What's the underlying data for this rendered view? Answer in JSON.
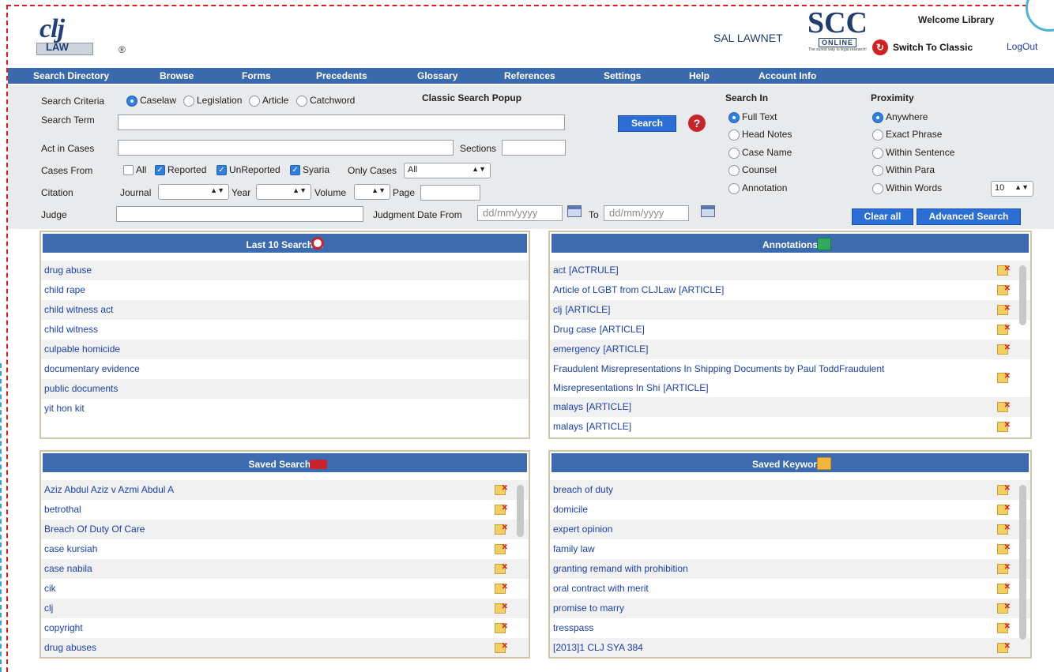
{
  "header": {
    "logo_text": "clj",
    "logo_sub": "LAW",
    "registered": "®",
    "partner1": "SAL LAWNET",
    "partner2_big": "SCC",
    "partner2_sub": "ONLINE",
    "partner2_tagline": "The surest way to legal research!",
    "welcome": "Welcome Library",
    "switch_label": "Switch To Classic",
    "logout_label": "LogOut"
  },
  "nav": {
    "items": [
      "Search Directory",
      "Browse",
      "Forms",
      "Precedents",
      "Glossary",
      "References",
      "Settings",
      "Help",
      "Account Info"
    ]
  },
  "search": {
    "criteria_label": "Search Criteria",
    "criteria_options": [
      "Caselaw",
      "Legislation",
      "Article",
      "Catchword"
    ],
    "criteria_selected": "Caselaw",
    "classic_popup_label": "Classic Search Popup",
    "search_term_label": "Search Term",
    "search_term_value": "",
    "search_button": "Search",
    "help_icon": "?",
    "act_label": "Act in Cases",
    "act_value": "",
    "sections_label": "Sections",
    "sections_value": "",
    "cases_from_label": "Cases From",
    "cases_from_options": [
      {
        "label": "All",
        "checked": false
      },
      {
        "label": "Reported",
        "checked": true
      },
      {
        "label": "UnReported",
        "checked": true
      },
      {
        "label": "Syaria",
        "checked": true
      }
    ],
    "only_cases_label": "Only Cases",
    "only_cases_value": "All",
    "citation_label": "Citation",
    "journal_label": "Journal",
    "journal_value": "",
    "year_label": "Year",
    "year_value": "",
    "volume_label": "Volume",
    "volume_value": "",
    "page_label": "Page",
    "page_value": "",
    "judge_label": "Judge",
    "judge_value": "",
    "judgment_date_label": "Judgment Date From",
    "date_from_placeholder": "dd/mm/yyyy",
    "to_label": "To",
    "date_to_placeholder": "dd/mm/yyyy",
    "search_in_label": "Search In",
    "search_in_options": [
      "Full Text",
      "Head Notes",
      "Case Name",
      "Counsel",
      "Annotation"
    ],
    "search_in_selected": "Full Text",
    "proximity_label": "Proximity",
    "proximity_options": [
      "Anywhere",
      "Exact Phrase",
      "Within Sentence",
      "Within Para",
      "Within Words"
    ],
    "proximity_selected": "Anywhere",
    "within_words_value": "10",
    "clear_button": "Clear all",
    "advanced_button": "Advanced Search"
  },
  "last_searches": {
    "title": "Last 10 Searches",
    "items": [
      "drug abuse",
      "child rape",
      "child witness act",
      "child witness",
      "culpable homicide",
      "documentary evidence",
      "public documents",
      "yit hon kit"
    ]
  },
  "annotations": {
    "title": "Annotations",
    "items": [
      {
        "name": "act",
        "tag": "[ACTRULE]"
      },
      {
        "name": "Article of LGBT from CLJLaw",
        "tag": "[ARTICLE]"
      },
      {
        "name": "clj",
        "tag": "[ARTICLE]"
      },
      {
        "name": "Drug case",
        "tag": "[ARTICLE]"
      },
      {
        "name": "emergency",
        "tag": "[ARTICLE]"
      },
      {
        "name": "Fraudulent Misrepresentations In Shipping Documents by Paul ToddFraudulent Misrepresentations In Shi",
        "tag": "[ARTICLE]"
      },
      {
        "name": "malays",
        "tag": "[ARTICLE]"
      },
      {
        "name": "malays",
        "tag": "[ARTICLE]"
      }
    ]
  },
  "saved_searches": {
    "title": "Saved Searches",
    "items": [
      "Aziz Abdul Aziz v Azmi Abdul A",
      "betrothal",
      "Breach Of Duty Of Care",
      "case kursiah",
      "case nabila",
      "cik",
      "clj",
      "copyright",
      "drug abuses"
    ]
  },
  "saved_keywords": {
    "title": "Saved Keywords",
    "items": [
      "breach of duty",
      "domicile",
      "expert opinion",
      "family law",
      "granting remand with prohibition",
      "oral contract with merit",
      "promise to marry",
      "tresspass",
      "[2013]1 CLJ SYA 384"
    ]
  },
  "colors": {
    "nav_bg": "#3a69ad",
    "panel_bg": "#e9eaec",
    "box_head": "#3d6bb0",
    "link": "#1a3fb0",
    "frame_red": "#e01b1b"
  },
  "icons": {
    "last_searches": "magnifier-icon",
    "annotations": "notepad-icon",
    "saved_searches": "books-icon",
    "saved_keywords": "note-edit-icon",
    "row_delete": "folder-delete-icon",
    "calendar": "calendar-icon",
    "help": "help-icon",
    "switch": "switch-icon"
  }
}
